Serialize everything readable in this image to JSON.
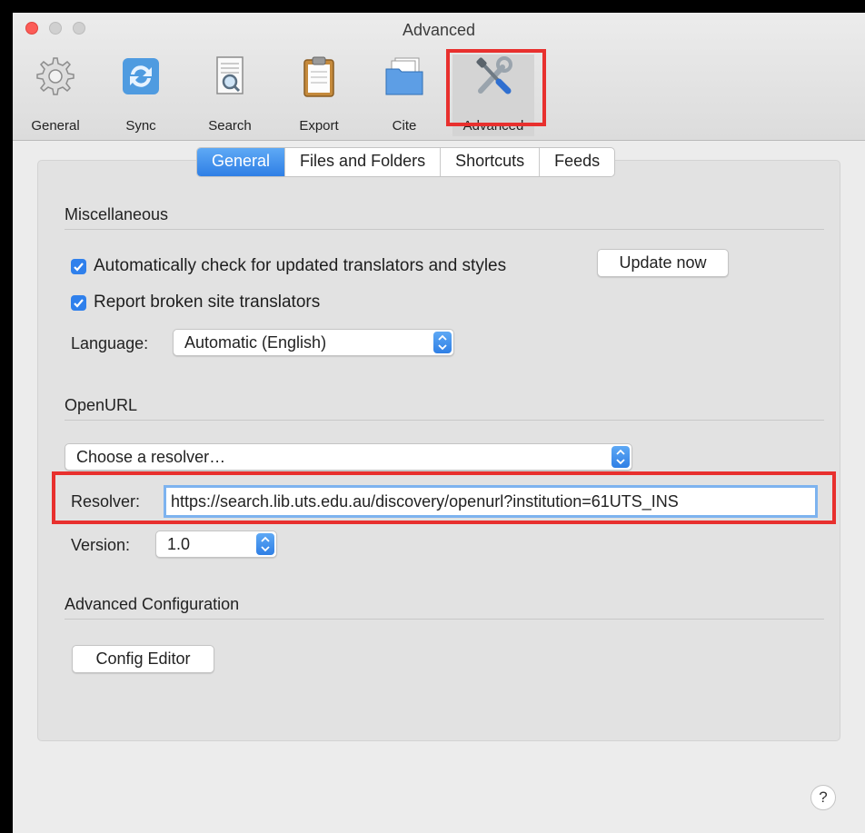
{
  "window": {
    "title": "Advanced"
  },
  "toolbar": {
    "items": [
      {
        "label": "General",
        "icon": "gear-icon"
      },
      {
        "label": "Sync",
        "icon": "sync-icon"
      },
      {
        "label": "Search",
        "icon": "search-icon"
      },
      {
        "label": "Export",
        "icon": "clipboard-icon"
      },
      {
        "label": "Cite",
        "icon": "folder-icon"
      },
      {
        "label": "Advanced",
        "icon": "tools-icon"
      }
    ],
    "selected": "Advanced"
  },
  "tabs": [
    {
      "label": "General",
      "active": true
    },
    {
      "label": "Files and Folders",
      "active": false
    },
    {
      "label": "Shortcuts",
      "active": false
    },
    {
      "label": "Feeds",
      "active": false
    }
  ],
  "miscellaneous": {
    "heading": "Miscellaneous",
    "auto_check_label": "Automatically check for updated translators and styles",
    "auto_check_checked": true,
    "update_now_label": "Update now",
    "report_broken_label": "Report broken site translators",
    "report_broken_checked": true,
    "language_label": "Language:",
    "language_value": "Automatic (English)"
  },
  "openurl": {
    "heading": "OpenURL",
    "resolver_select_value": "Choose a resolver…",
    "resolver_label": "Resolver:",
    "resolver_value": "https://search.lib.uts.edu.au/discovery/openurl?institution=61UTS_INS",
    "version_label": "Version:",
    "version_value": "1.0"
  },
  "advanced_config": {
    "heading": "Advanced Configuration",
    "config_editor_label": "Config Editor"
  },
  "help_label": "?",
  "colors": {
    "accent": "#2f80ec",
    "highlight_box": "#e8302e"
  }
}
